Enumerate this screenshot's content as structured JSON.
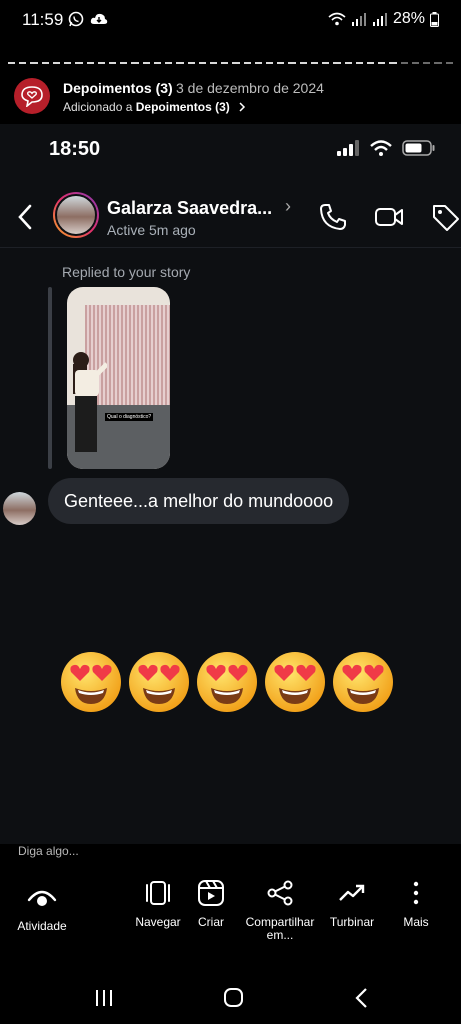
{
  "status_bar": {
    "time": "11:59",
    "battery": "28%"
  },
  "story": {
    "title": "Depoimentos (3)",
    "date": "3 de dezembro de 2024",
    "added_prefix": "Adicionado a ",
    "added_highlight": "Depoimentos (3)"
  },
  "chat": {
    "ios_time": "18:50",
    "contact_name": "Galarza Saavedra...",
    "contact_status": "Active 5m ago",
    "replied_label": "Replied to your story",
    "story_caption": "Qual o diagnóstico? ",
    "message": "Genteee...a melhor do mundoooo",
    "emojis": [
      "smiling-face-with-heart-eyes",
      "smiling-face-with-heart-eyes",
      "smiling-face-with-heart-eyes",
      "smiling-face-with-heart-eyes",
      "smiling-face-with-heart-eyes"
    ]
  },
  "reply_prompt": "Diga algo...",
  "actions": [
    {
      "label": "Atividade",
      "icon": "eye-icon"
    },
    {
      "label": "Navegar",
      "icon": "pages-icon"
    },
    {
      "label": "Criar",
      "icon": "reels-icon"
    },
    {
      "label": "Compartilhar em...",
      "icon": "share-icon"
    },
    {
      "label": "Turbinar",
      "icon": "trend-icon"
    },
    {
      "label": "Mais",
      "icon": "more-vertical-icon"
    }
  ],
  "colors": {
    "background": "#000000",
    "chat_bg": "#0d0f12",
    "bubble": "#26292f",
    "highlight_avatar": "#b61f2a"
  }
}
